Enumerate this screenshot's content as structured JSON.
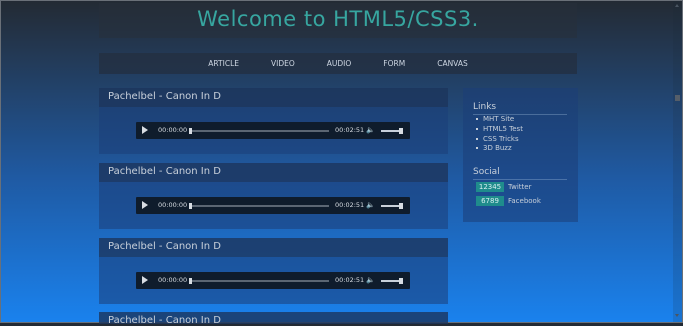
{
  "header": {
    "title": "Welcome to HTML5/CSS3."
  },
  "nav": {
    "items": [
      "ARTICLE",
      "VIDEO",
      "AUDIO",
      "FORM",
      "CANVAS"
    ]
  },
  "sections": [
    {
      "title": "Pachelbel - Canon In D",
      "player": {
        "current_time": "00:00:00",
        "duration": "00:02:51",
        "progress": 0.0
      }
    },
    {
      "title": "Pachelbel - Canon In D",
      "player": {
        "current_time": "00:00:00",
        "duration": "00:02:51",
        "progress": 0.0
      }
    },
    {
      "title": "Pachelbel - Canon In D",
      "player": {
        "current_time": "00:00:00",
        "duration": "00:02:51",
        "progress": 0.0
      }
    },
    {
      "title": "Pachelbel - Canon In D"
    }
  ],
  "sidebar": {
    "links_heading": "Links",
    "links": [
      "MHT Site",
      "HTML5 Test",
      "CSS Tricks",
      "3D Buzz"
    ],
    "social_heading": "Social",
    "social": [
      {
        "count": "12345",
        "name": "Twitter"
      },
      {
        "count": "6789",
        "name": "Facebook"
      }
    ]
  },
  "icons": {
    "play": "play-icon",
    "volume": "volume-icon"
  },
  "colors": {
    "title": "#37a6a0",
    "badge": "#1f8c8c",
    "text": "#c8d0da"
  }
}
